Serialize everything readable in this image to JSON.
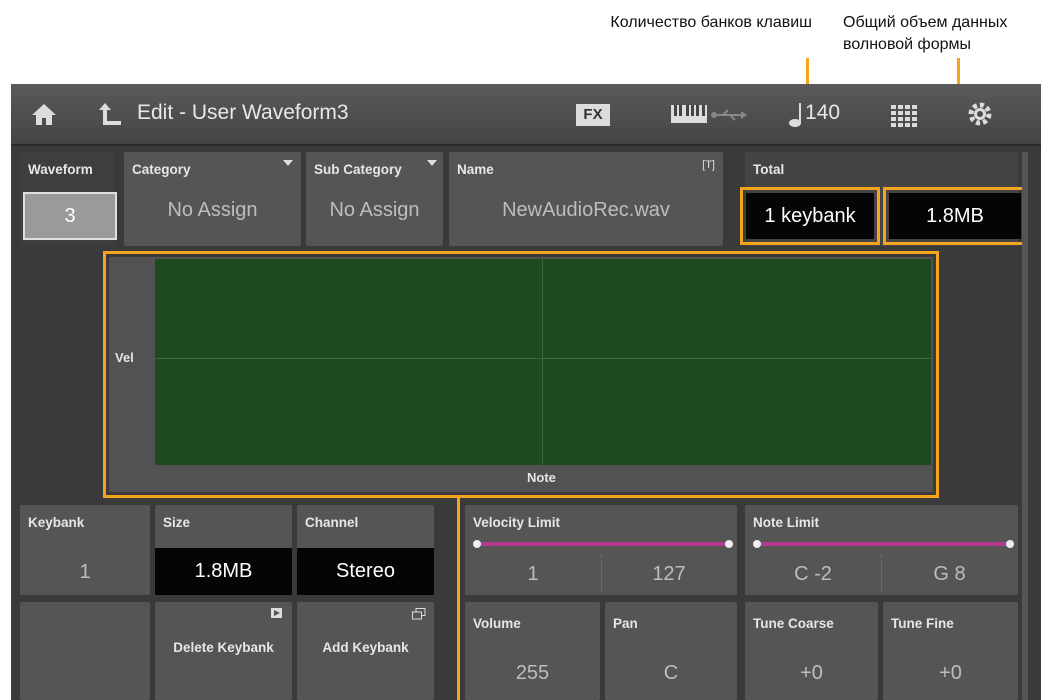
{
  "annotations": {
    "keybank_count": "Количество банков клавиш",
    "total_size": "Общий объем данных волновой формы"
  },
  "header": {
    "title": "Edit - User Waveform3",
    "fx_label": "FX",
    "tempo_value": "140",
    "icons": [
      "home-icon",
      "back-arrow-icon",
      "fx-icon",
      "keyboard-icon",
      "usb-icon",
      "note-icon",
      "grid-icon",
      "gear-icon"
    ]
  },
  "waveform": {
    "label": "Waveform",
    "value": "3"
  },
  "category": {
    "label": "Category",
    "value": "No Assign"
  },
  "sub_category": {
    "label": "Sub Category",
    "value": "No Assign"
  },
  "name": {
    "label": "Name",
    "value": "NewAudioRec.wav",
    "badge": "[T]"
  },
  "total": {
    "label": "Total",
    "keybanks": "1 keybank",
    "size": "1.8MB"
  },
  "graph": {
    "y_label": "Vel",
    "x_label": "Note"
  },
  "keybank": {
    "label": "Keybank",
    "value": "1"
  },
  "size": {
    "label": "Size",
    "value": "1.8MB"
  },
  "channel": {
    "label": "Channel",
    "value": "Stereo"
  },
  "velocity_limit": {
    "label": "Velocity Limit",
    "low": "1",
    "high": "127"
  },
  "note_limit": {
    "label": "Note Limit",
    "low": "C -2",
    "high": "G 8"
  },
  "delete_keybank": {
    "label": "Delete Keybank"
  },
  "add_keybank": {
    "label": "Add Keybank"
  },
  "volume": {
    "label": "Volume",
    "value": "255"
  },
  "pan": {
    "label": "Pan",
    "value": "C"
  },
  "tune_coarse": {
    "label": "Tune Coarse",
    "value": "+0"
  },
  "tune_fine": {
    "label": "Tune Fine",
    "value": "+0"
  },
  "colors": {
    "highlight": "#f5a51d",
    "graph_bg": "#1d4a1f",
    "slider": "#b23b8f"
  }
}
